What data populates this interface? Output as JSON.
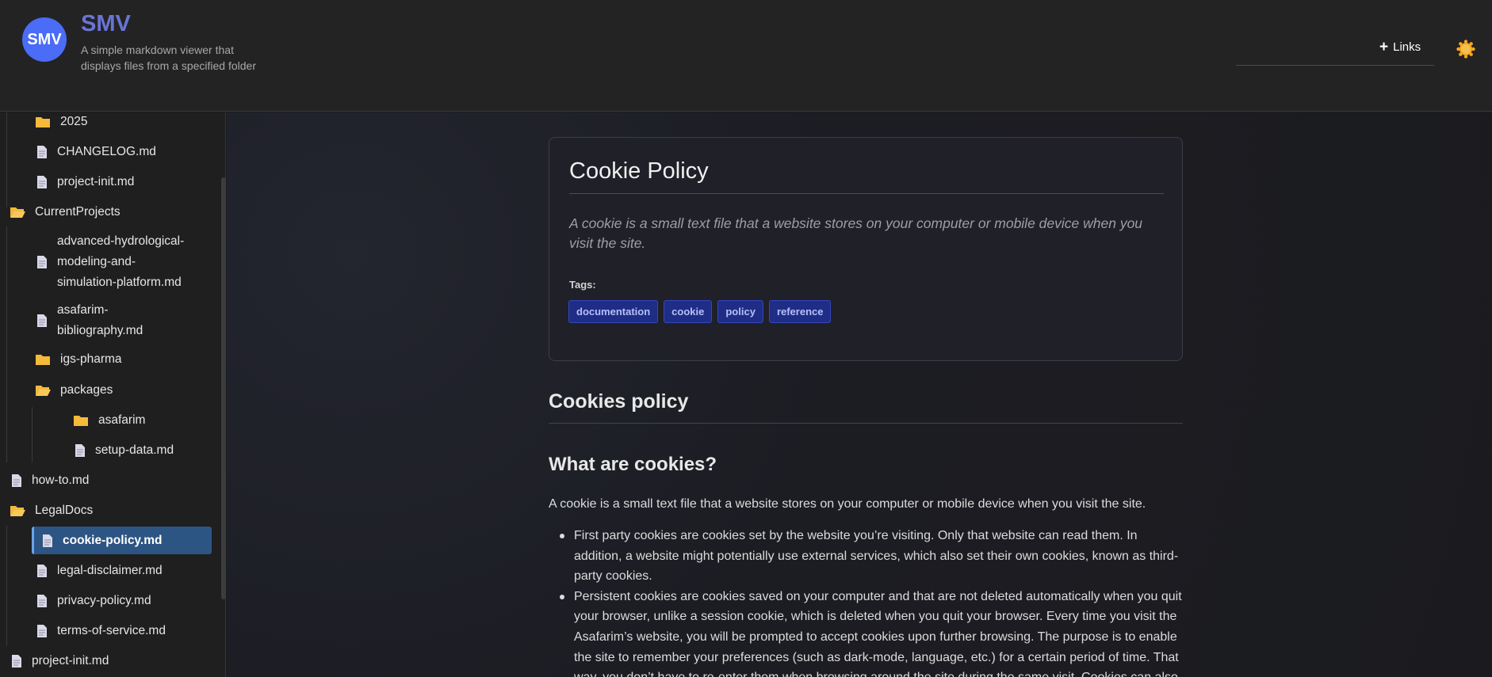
{
  "header": {
    "logo_text": "SMV",
    "title": "SMV",
    "description": "A simple markdown viewer that displays files from a specified folder",
    "links_label": "Links",
    "theme_icon": "sun-icon"
  },
  "sidebar": {
    "items": [
      {
        "label": "2025",
        "type": "folder"
      },
      {
        "label": "CHANGELOG.md",
        "type": "file"
      },
      {
        "label": "project-init.md",
        "type": "file"
      },
      {
        "label": "CurrentProjects",
        "type": "folder-open"
      },
      {
        "label": "advanced-hydrological-modeling-and-simulation-platform.md",
        "type": "file"
      },
      {
        "label": "asafarim-bibliography.md",
        "type": "file"
      },
      {
        "label": "igs-pharma",
        "type": "folder"
      },
      {
        "label": "packages",
        "type": "folder-open"
      },
      {
        "label": "asafarim",
        "type": "folder"
      },
      {
        "label": "setup-data.md",
        "type": "file"
      },
      {
        "label": "how-to.md",
        "type": "file"
      },
      {
        "label": "LegalDocs",
        "type": "folder-open"
      },
      {
        "label": "cookie-policy.md",
        "type": "file",
        "selected": true
      },
      {
        "label": "legal-disclaimer.md",
        "type": "file"
      },
      {
        "label": "privacy-policy.md",
        "type": "file"
      },
      {
        "label": "terms-of-service.md",
        "type": "file"
      },
      {
        "label": "project-init.md",
        "type": "file"
      }
    ],
    "wrapped": {
      "hydro_1": "advanced-hydrological-",
      "hydro_2": "modeling-and-",
      "hydro_3": "simulation-platform.md",
      "bib_1": "asafarim-",
      "bib_2": "bibliography.md"
    }
  },
  "document": {
    "title": "Cookie Policy",
    "description": "A cookie is a small text file that a website stores on your computer or mobile device when you visit the site.",
    "tags_label": "Tags:",
    "tags": [
      "documentation",
      "cookie",
      "policy",
      "reference"
    ],
    "h2": "Cookies policy",
    "h3": "What are cookies?",
    "paragraph": "A cookie is a small text file that a website stores on your computer or mobile device when you visit the site.",
    "bullets": [
      "First party cookies are cookies set by the website you’re visiting. Only that website can read them. In addition, a website might potentially use external services, which also set their own cookies, known as third-party cookies.",
      "Persistent cookies are cookies saved on your computer and that are not deleted automatically when you quit your browser, unlike a session cookie, which is deleted when you quit your browser. Every time you visit the Asafarim’s website, you will be prompted to accept cookies upon further browsing. The purpose is to enable the site to remember your preferences (such as dark-mode, language, etc.) for a certain period of time. That way, you don’t have to re-enter them when browsing around the site during the same visit. Cookies can also"
    ]
  },
  "colors": {
    "accent": "#6a74d6",
    "logo_bg": "#4a6cf7",
    "selected_bg": "#2d5583",
    "tag_bg": "#1f2d87",
    "folder": "#f5b93c"
  }
}
